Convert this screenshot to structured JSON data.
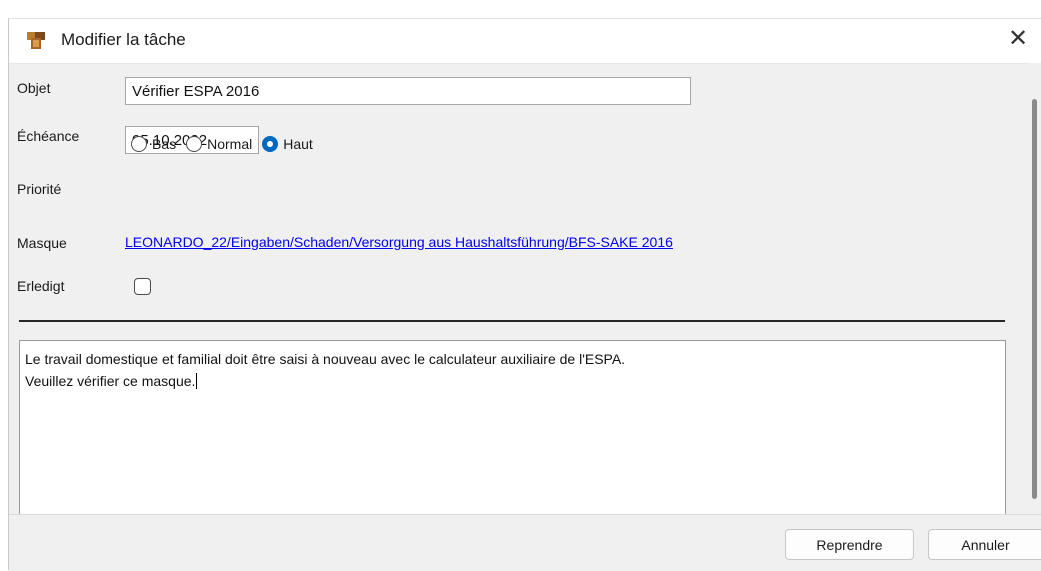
{
  "dialog": {
    "title": "Modifier la tâche",
    "close_symbol": "✕"
  },
  "form": {
    "subject": {
      "label": "Objet",
      "value": "Vérifier ESPA 2016"
    },
    "due_date": {
      "label": "Échéance",
      "value": "05.10.2022"
    },
    "priority": {
      "label": "Priorité",
      "options": [
        {
          "label": "Bas",
          "selected": false
        },
        {
          "label": "Normal",
          "selected": false
        },
        {
          "label": "Haut",
          "selected": true
        }
      ]
    },
    "mask": {
      "label": "Masque",
      "link_text": "LEONARDO_22/Eingaben/Schaden/Versorgung aus Haushaltsführung/BFS-SAKE 2016"
    },
    "done": {
      "label": "Erledigt",
      "checked": false
    }
  },
  "notes": {
    "lines": [
      "Le travail domestique et familial doit être saisi à nouveau avec le calculateur auxiliaire de l'ESPA.",
      "Veuillez vérifier ce masque."
    ]
  },
  "buttons": {
    "apply": "Reprendre",
    "cancel": "Annuler"
  },
  "colors": {
    "accent": "#0067c0",
    "link": "#0000ee",
    "panel_background": "#f0f0f0"
  },
  "icons": {
    "app": "task-folder-icon",
    "close": "close-icon"
  }
}
